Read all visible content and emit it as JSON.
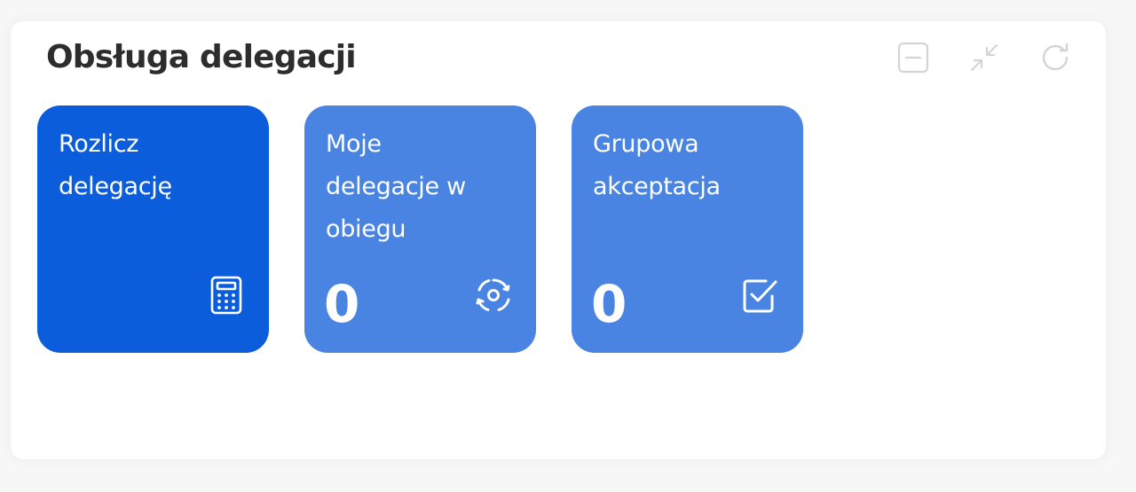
{
  "widget": {
    "title": "Obsługa delegacji",
    "controls": [
      {
        "icon": "minimize-square-icon",
        "label": "Minimize"
      },
      {
        "icon": "collapse-arrows-icon",
        "label": "Collapse"
      },
      {
        "icon": "refresh-icon",
        "label": "Refresh"
      }
    ]
  },
  "tiles": [
    {
      "label": "Rozlicz delegację",
      "count": null,
      "icon": "calculator-icon",
      "color": "#0b5ddc"
    },
    {
      "label": "Moje delegacje w obiegu",
      "count": "0",
      "icon": "circular-arrows-icon",
      "color": "#4a84e3"
    },
    {
      "label": "Grupowa akceptacja",
      "count": "0",
      "icon": "checkbox-icon",
      "color": "#4a84e3"
    }
  ],
  "colors": {
    "primary": "#0b5ddc",
    "secondary": "#4a84e3",
    "control_gray": "#d4d4d4",
    "title": "#2d2d2d"
  }
}
